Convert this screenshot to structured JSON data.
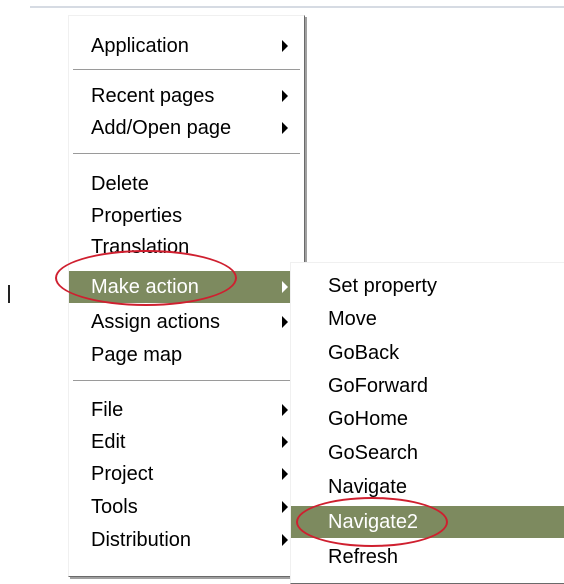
{
  "top_fragment": "_",
  "annotation_color": "#cf1f2f",
  "highlight_color": "#7d8a5f",
  "main_menu": {
    "items": [
      {
        "label": "Application",
        "submenu": true
      },
      {
        "label": "Recent pages",
        "submenu": true
      },
      {
        "label": "Add/Open page",
        "submenu": true
      },
      {
        "label": "Delete",
        "submenu": false
      },
      {
        "label": "Properties",
        "submenu": false
      },
      {
        "label": "Translation",
        "submenu": false
      },
      {
        "label": "Make action",
        "submenu": true,
        "highlighted": true,
        "circled": true
      },
      {
        "label": "Assign actions",
        "submenu": true
      },
      {
        "label": "Page map",
        "submenu": false
      },
      {
        "label": "File",
        "submenu": true
      },
      {
        "label": "Edit",
        "submenu": true
      },
      {
        "label": "Project",
        "submenu": true
      },
      {
        "label": "Tools",
        "submenu": true
      },
      {
        "label": "Distribution",
        "submenu": true
      }
    ]
  },
  "sub_menu": {
    "items": [
      {
        "label": "Set property"
      },
      {
        "label": "Move"
      },
      {
        "label": "GoBack"
      },
      {
        "label": "GoForward"
      },
      {
        "label": "GoHome"
      },
      {
        "label": "GoSearch"
      },
      {
        "label": "Navigate"
      },
      {
        "label": "Navigate2",
        "highlighted": true,
        "circled": true
      },
      {
        "label": "Refresh"
      }
    ]
  }
}
